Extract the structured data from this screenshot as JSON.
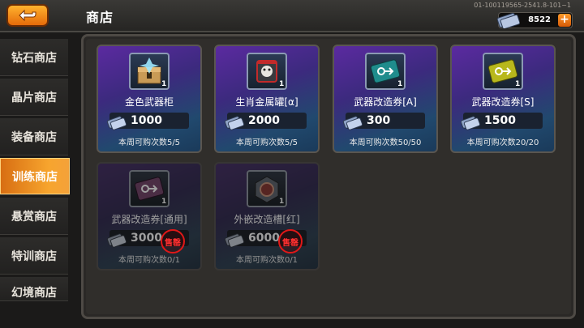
{
  "header": {
    "title": "商店",
    "server_id": "01-100119565-2541.8-101~1",
    "currency_amount": "8522",
    "add_label": "+"
  },
  "sidebar": {
    "items": [
      {
        "label": "钻石商店",
        "active": false
      },
      {
        "label": "晶片商店",
        "active": false
      },
      {
        "label": "装备商店",
        "active": false
      },
      {
        "label": "训练商店",
        "active": true
      },
      {
        "label": "悬赏商店",
        "active": false
      },
      {
        "label": "特训商店",
        "active": false
      },
      {
        "label": "幻境商店",
        "active": false
      }
    ]
  },
  "shop": {
    "items": [
      {
        "name": "金色武器柜",
        "count": "1",
        "price": "1000",
        "limit": "本周可购次数5/5",
        "icon": "gold-weapon-cabinet-icon",
        "sold_out": false
      },
      {
        "name": "生肖金属罐[α]",
        "count": "1",
        "price": "2000",
        "limit": "本周可购次数5/5",
        "icon": "zodiac-metal-can-icon",
        "sold_out": false
      },
      {
        "name": "武器改造券[A]",
        "count": "1",
        "price": "300",
        "limit": "本周可购次数50/50",
        "icon": "weapon-mod-ticket-a-icon",
        "sold_out": false
      },
      {
        "name": "武器改造券[S]",
        "count": "1",
        "price": "1500",
        "limit": "本周可购次数20/20",
        "icon": "weapon-mod-ticket-s-icon",
        "sold_out": false
      },
      {
        "name": "武器改造券[通用]",
        "count": "1",
        "price": "3000",
        "limit": "本周可购次数0/1",
        "icon": "weapon-mod-ticket-universal-icon",
        "sold_out": true,
        "sold_out_label": "售罄"
      },
      {
        "name": "外嵌改造槽[红]",
        "count": "1",
        "price": "6000",
        "limit": "本周可购次数0/1",
        "icon": "external-mod-slot-red-icon",
        "sold_out": true,
        "sold_out_label": "售罄"
      }
    ]
  },
  "colors": {
    "accent": "#f29a2e",
    "sold_out": "#e01818"
  }
}
